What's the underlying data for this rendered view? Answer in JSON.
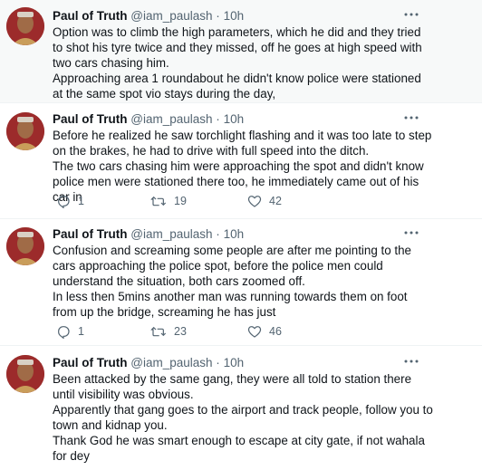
{
  "tweets": [
    {
      "name": "Paul of Truth",
      "handle": "@iam_paulash",
      "separator": "·",
      "time": "10h",
      "lines": [
        "Option was to climb the high parameters, which he did and they tried to shot his tyre twice and they missed, off he goes at high speed with two cars chasing him.",
        "Approaching area 1 roundabout he didn't know police were stationed at the same spot vio stays during the day,"
      ]
    },
    {
      "name": "Paul of Truth",
      "handle": "@iam_paulash",
      "separator": "·",
      "time": "10h",
      "lines": [
        "Before he realized he saw torchlight flashing and it was too late to step on the brakes, he had to drive with full speed into the ditch.",
        "The two cars chasing him were approaching the spot and didn't know police men were stationed there too, he immediately came out of his car in"
      ],
      "replies": "1",
      "retweets": "19",
      "likes": "42"
    },
    {
      "name": "Paul of Truth",
      "handle": "@iam_paulash",
      "separator": "·",
      "time": "10h",
      "lines": [
        "Confusion and screaming some people are after me pointing to the cars approaching the police spot, before the police men could understand the situation, both cars zoomed off.",
        "In less then 5mins another man was running towards them on foot from up the bridge, screaming he has just"
      ],
      "replies": "1",
      "retweets": "23",
      "likes": "46"
    },
    {
      "name": "Paul of Truth",
      "handle": "@iam_paulash",
      "separator": "·",
      "time": "10h",
      "lines": [
        "Been attacked by the same gang, they were all told to station there until visibility was obvious.",
        "Apparently that gang goes to the airport and track people, follow you to town and kidnap you.",
        "Thank God he was smart enough to escape at city gate, if not wahala for dey"
      ]
    }
  ],
  "icons": {
    "more": "more-dots-icon",
    "reply": "reply-bubble-icon",
    "retweet": "retweet-arrows-icon",
    "like": "heart-outline-icon"
  },
  "colors": {
    "text": "#0f1419",
    "secondary": "#536471",
    "divider": "#eff3f4",
    "highlight_bg": "#f7f9f9"
  }
}
